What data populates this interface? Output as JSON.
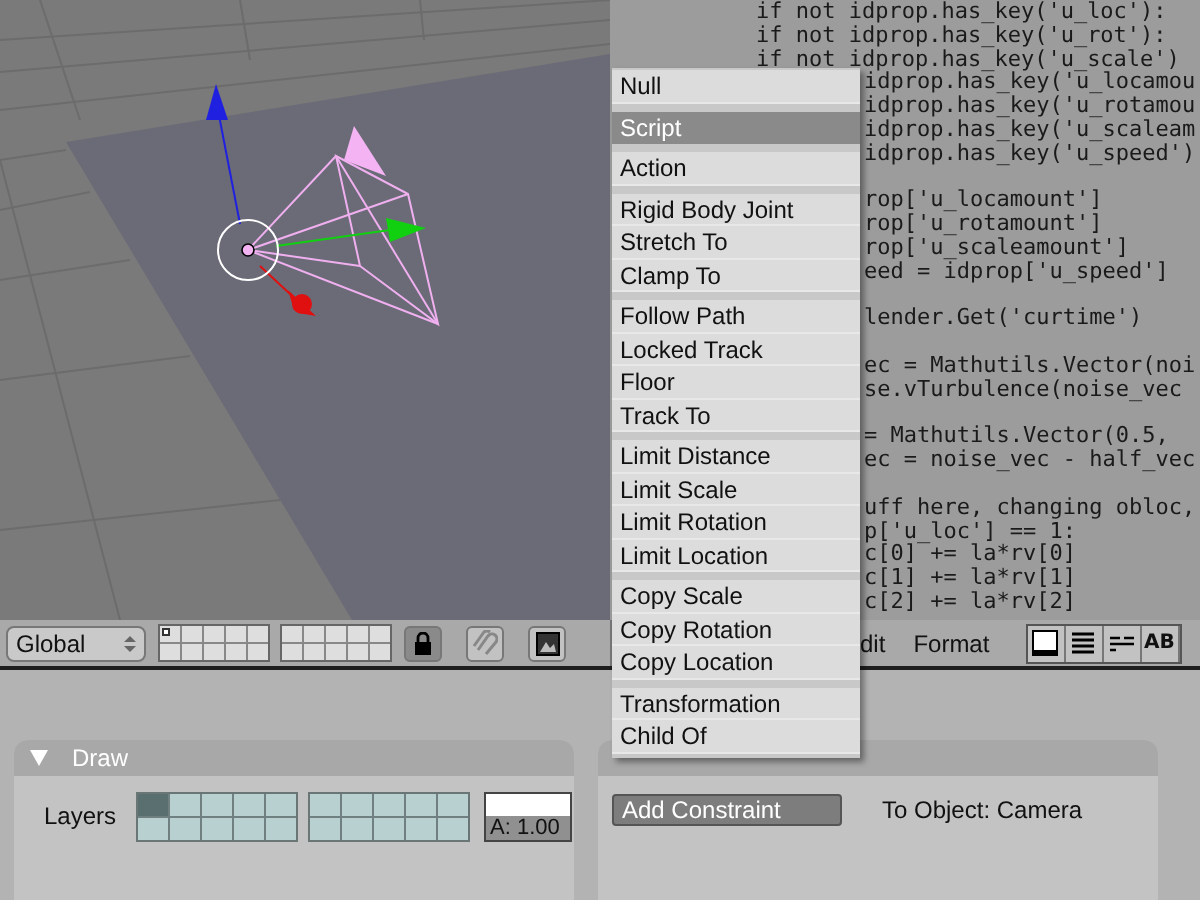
{
  "viewport_header": {
    "orientation": "Global",
    "layers": [
      {
        "selected": true
      },
      {
        "selected": false
      },
      {
        "selected": false
      },
      {
        "selected": false
      },
      {
        "selected": false
      },
      {
        "selected": false
      },
      {
        "selected": false
      },
      {
        "selected": false
      },
      {
        "selected": false
      },
      {
        "selected": false
      },
      {
        "selected": false
      },
      {
        "selected": false
      },
      {
        "selected": false
      },
      {
        "selected": false
      },
      {
        "selected": false
      },
      {
        "selected": false
      },
      {
        "selected": false
      },
      {
        "selected": false
      },
      {
        "selected": false
      },
      {
        "selected": false
      }
    ],
    "lock": {
      "on": true
    }
  },
  "text_editor": {
    "code_lines": [
      {
        "kind": "full",
        "text": "if not idprop.has_key('u_loc'):"
      },
      {
        "kind": "full",
        "text": "if not idprop.has_key('u_rot'):"
      },
      {
        "kind": "full",
        "text": "if not idprop.has_key('u_scale')"
      },
      {
        "kind": "partial",
        "text": "idprop.has_key('u_locamou"
      },
      {
        "kind": "partial",
        "text": "idprop.has_key('u_rotamou"
      },
      {
        "kind": "partial",
        "text": "idprop.has_key('u_scaleam"
      },
      {
        "kind": "partial",
        "text": "idprop.has_key('u_speed')"
      },
      {
        "kind": "blank"
      },
      {
        "kind": "partial",
        "text": "rop['u_locamount']"
      },
      {
        "kind": "partial",
        "text": "rop['u_rotamount']"
      },
      {
        "kind": "partial",
        "text": "rop['u_scaleamount']"
      },
      {
        "kind": "partial",
        "text": "eed = idprop['u_speed']"
      },
      {
        "kind": "blank"
      },
      {
        "kind": "partial",
        "text": "lender.Get('curtime')"
      },
      {
        "kind": "blank"
      },
      {
        "kind": "partial",
        "text": "ec = Mathutils.Vector(noi"
      },
      {
        "kind": "partial",
        "text": "se.vTurbulence(noise_vec"
      },
      {
        "kind": "blank"
      },
      {
        "kind": "partial",
        "text": "= Mathutils.Vector(0.5,"
      },
      {
        "kind": "partial",
        "text": "ec = noise_vec - half_vec"
      },
      {
        "kind": "blank"
      },
      {
        "kind": "partial",
        "text": "uff here, changing obloc,"
      },
      {
        "kind": "partial",
        "text": "p['u_loc'] == 1:"
      },
      {
        "kind": "partial",
        "text": "c[0] += la*rv[0]"
      },
      {
        "kind": "partial",
        "text": "c[1] += la*rv[1]"
      },
      {
        "kind": "partial",
        "text": "c[2] += la*rv[2]"
      }
    ]
  },
  "text_header": {
    "menus": [
      "dit",
      "Format"
    ],
    "ab_button": "AB"
  },
  "buttons_window": {
    "draw_panel": {
      "title": "Draw",
      "expanded": true,
      "layers_label": "Layers",
      "layers": [
        {
          "selected": true
        },
        {
          "selected": false
        },
        {
          "selected": false
        },
        {
          "selected": false
        },
        {
          "selected": false
        },
        {
          "selected": false
        },
        {
          "selected": false
        },
        {
          "selected": false
        },
        {
          "selected": false
        },
        {
          "selected": false
        },
        {
          "selected": false
        },
        {
          "selected": false
        },
        {
          "selected": false
        },
        {
          "selected": false
        },
        {
          "selected": false
        },
        {
          "selected": false
        },
        {
          "selected": false
        },
        {
          "selected": false
        },
        {
          "selected": false
        },
        {
          "selected": false
        }
      ],
      "alpha": "A: 1.00"
    },
    "constraints_panel": {
      "add_button": "Add Constraint",
      "target": "To Object: Camera"
    }
  },
  "constraint_menu": {
    "groups": [
      [
        {
          "label": "Null",
          "selected": false
        }
      ],
      [
        {
          "label": "Script",
          "selected": true
        }
      ],
      [
        {
          "label": "Action",
          "selected": false
        }
      ],
      [
        {
          "label": "Rigid Body Joint",
          "selected": false
        },
        {
          "label": "Stretch To",
          "selected": false
        },
        {
          "label": "Clamp To",
          "selected": false
        }
      ],
      [
        {
          "label": "Follow Path",
          "selected": false
        },
        {
          "label": "Locked Track",
          "selected": false
        },
        {
          "label": "Floor",
          "selected": false
        },
        {
          "label": "Track To",
          "selected": false
        }
      ],
      [
        {
          "label": "Limit Distance",
          "selected": false
        },
        {
          "label": "Limit Scale",
          "selected": false
        },
        {
          "label": "Limit Rotation",
          "selected": false
        },
        {
          "label": "Limit Location",
          "selected": false
        }
      ],
      [
        {
          "label": "Copy Scale",
          "selected": false
        },
        {
          "label": "Copy Rotation",
          "selected": false
        },
        {
          "label": "Copy Location",
          "selected": false
        }
      ],
      [
        {
          "label": "Transformation",
          "selected": false
        },
        {
          "label": "Child Of",
          "selected": false
        }
      ]
    ]
  }
}
